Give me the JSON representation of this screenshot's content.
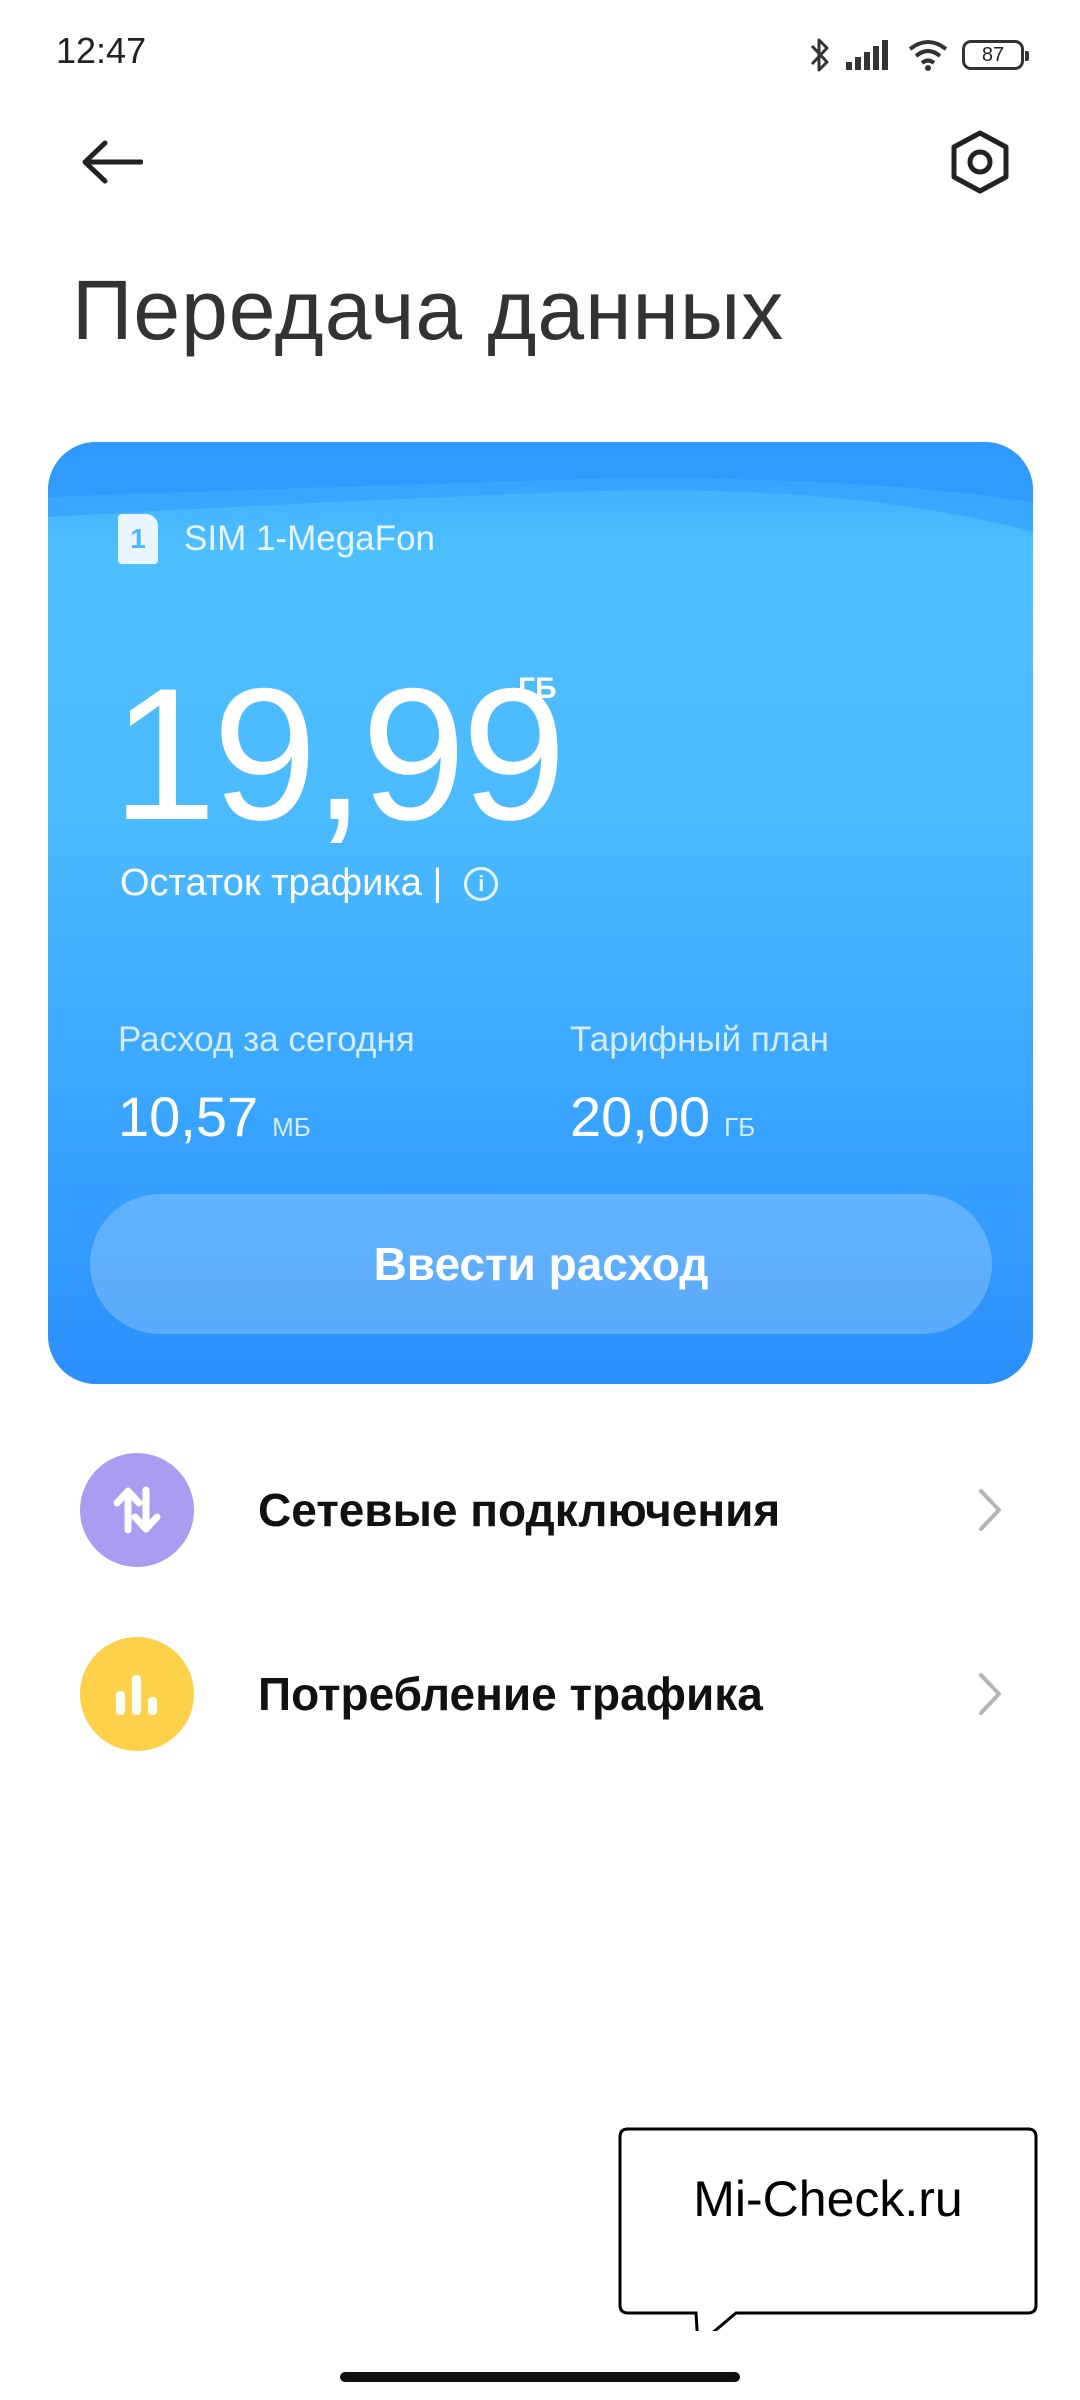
{
  "status_bar": {
    "time": "12:47",
    "battery": "87",
    "icons": [
      "bluetooth-icon",
      "signal-icon",
      "wifi-icon",
      "battery-icon"
    ]
  },
  "header": {
    "back_icon": "back-arrow-icon",
    "settings_icon": "settings-hexagon-icon",
    "title": "Передача данных"
  },
  "card": {
    "sim_number": "1",
    "sim_label": "SIM 1-MegaFon",
    "remaining_value": "19,99",
    "remaining_unit": "ГБ",
    "remaining_label": "Остаток трафика |",
    "today_label": "Расход за сегодня",
    "today_value": "10,57",
    "today_unit": "МБ",
    "plan_label": "Тарифный план",
    "plan_value": "20,00",
    "plan_unit": "ГБ",
    "enter_button": "Ввести расход",
    "colors": {
      "card_top": "#3aa7ff",
      "card_bottom": "#2b8ffb"
    }
  },
  "list": [
    {
      "label": "Сетевые подключения",
      "icon": "up-down-arrows-icon",
      "color": "#a89df0"
    },
    {
      "label": "Потребление трафика",
      "icon": "bar-chart-icon",
      "color": "#ffd04a"
    }
  ],
  "watermark": {
    "text": "Mi-Check.ru"
  }
}
